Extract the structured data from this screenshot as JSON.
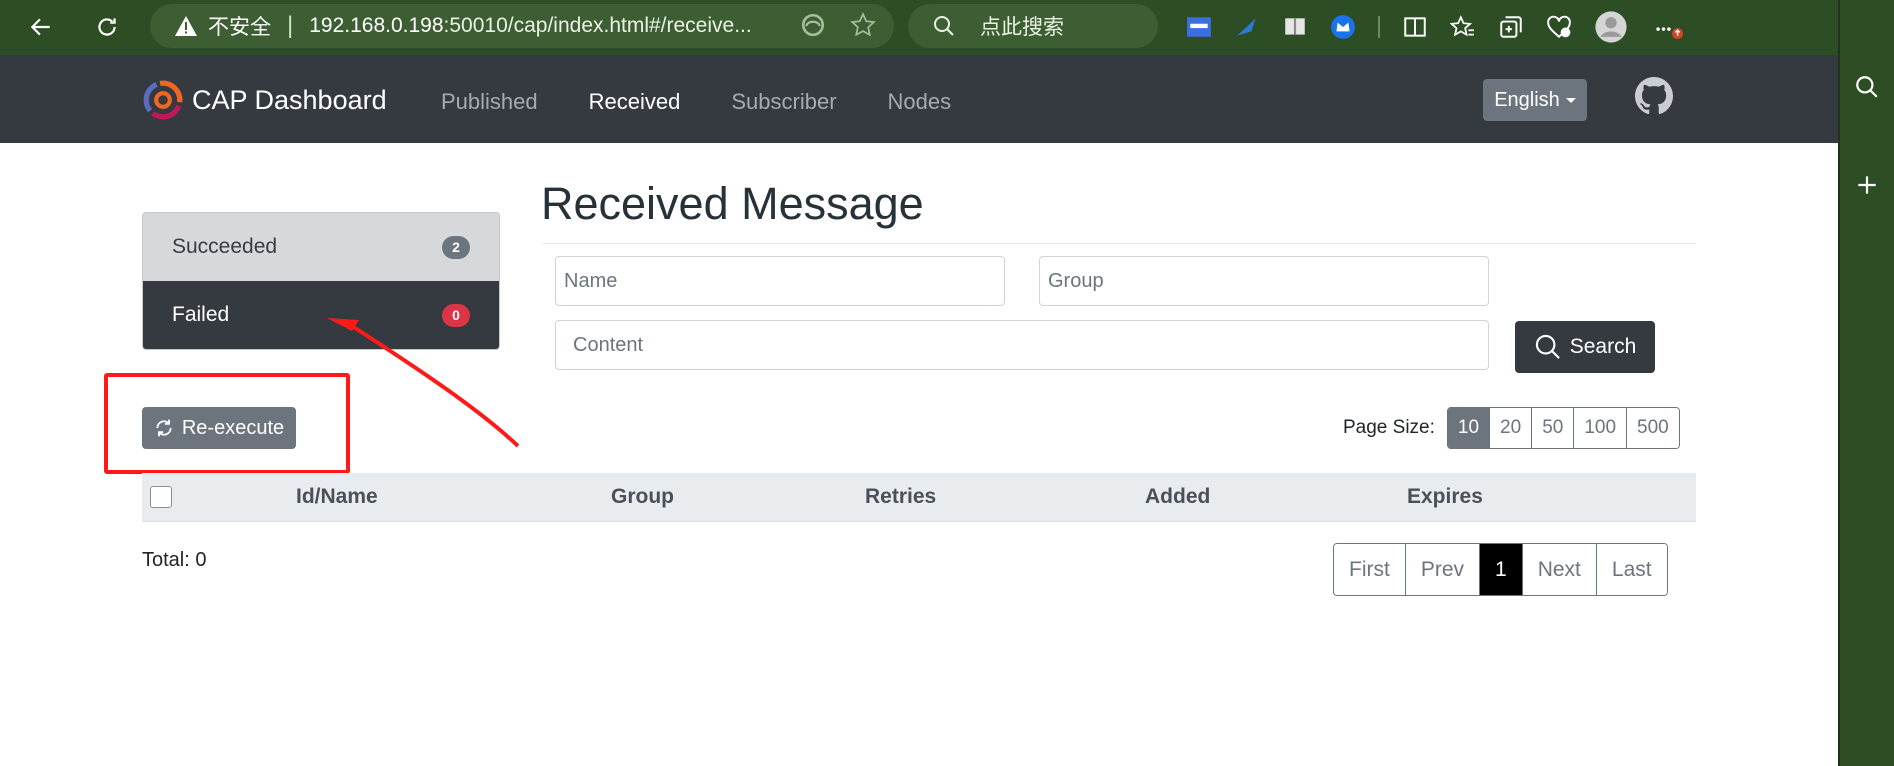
{
  "browser": {
    "security_label": "不安全",
    "url_host": "192.168.0.198",
    "url_path": ":50010/cap/index.html#/receive...",
    "search_placeholder": "点此搜索"
  },
  "navbar": {
    "brand": "CAP Dashboard",
    "links": [
      {
        "label": "Published",
        "active": false
      },
      {
        "label": "Received",
        "active": true
      },
      {
        "label": "Subscriber",
        "active": false
      },
      {
        "label": "Nodes",
        "active": false
      }
    ],
    "language": "English"
  },
  "status_list": [
    {
      "label": "Succeeded",
      "count": "2",
      "badge_color": "#6c757d"
    },
    {
      "label": "Failed",
      "count": "0",
      "badge_color": "#dc3545"
    }
  ],
  "reexecute_label": "Re-execute",
  "page_title": "Received Message",
  "filters": {
    "name_placeholder": "Name",
    "group_placeholder": "Group",
    "content_placeholder": "Content",
    "search_label": "Search"
  },
  "page_size": {
    "label": "Page Size:",
    "options": [
      "10",
      "20",
      "50",
      "100",
      "500"
    ],
    "selected": "10"
  },
  "table": {
    "columns": [
      "Id/Name",
      "Group",
      "Retries",
      "Added",
      "Expires"
    ]
  },
  "total_label": "Total: 0",
  "pagination": {
    "first": "First",
    "prev": "Prev",
    "current": "1",
    "next": "Next",
    "last": "Last"
  },
  "colors": {
    "browser_chrome": "#2d4d25",
    "navbar": "#343a40",
    "annotation": "#ff1a1a"
  }
}
